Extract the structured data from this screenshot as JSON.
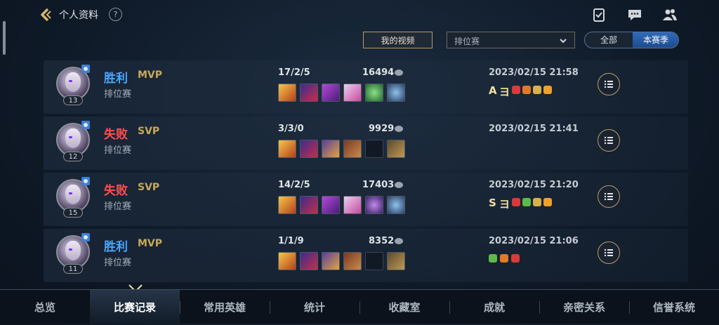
{
  "header": {
    "title": "个人资料",
    "help_label": "?",
    "icons": [
      "back-chevron-icon",
      "checklist-icon",
      "chat-icon",
      "friends-icon"
    ]
  },
  "filters": {
    "video_button": "我的视频",
    "mode_select": "排位赛",
    "season_toggle": {
      "options": [
        "全部",
        "本赛季"
      ],
      "selected": "本赛季"
    }
  },
  "matches": [
    {
      "result": "胜利",
      "result_type": "win",
      "tag": "MVP",
      "mode": "排位赛",
      "level": "13",
      "kda": "17/2/5",
      "score": "16494",
      "time": "2023/02/15 21:58",
      "grade": "A"
    },
    {
      "result": "失败",
      "result_type": "lose",
      "tag": "SVP",
      "mode": "排位赛",
      "level": "12",
      "kda": "3/3/0",
      "score": "9929",
      "time": "2023/02/15 21:41",
      "grade": ""
    },
    {
      "result": "失败",
      "result_type": "lose",
      "tag": "SVP",
      "mode": "排位赛",
      "level": "15",
      "kda": "14/2/5",
      "score": "17403",
      "time": "2023/02/15 21:20",
      "grade": "S"
    },
    {
      "result": "胜利",
      "result_type": "win",
      "tag": "MVP",
      "mode": "排位赛",
      "level": "11",
      "kda": "1/1/9",
      "score": "8352",
      "time": "2023/02/15 21:06",
      "grade": ""
    }
  ],
  "bottom_nav": {
    "tabs": [
      "总览",
      "比赛记录",
      "常用英雄",
      "统计",
      "收藏室",
      "成就",
      "亲密关系",
      "信誉系统"
    ],
    "active": "比赛记录"
  },
  "colors": {
    "win": "#46a8ff",
    "lose": "#ff4d4d",
    "accent_gold": "#c9a857"
  }
}
